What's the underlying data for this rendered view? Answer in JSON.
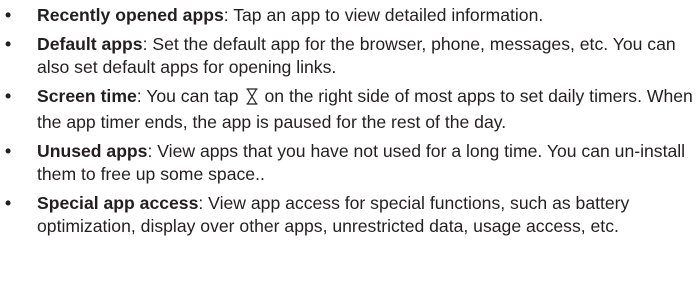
{
  "bullet_symbol": "•",
  "items": [
    {
      "term": "Recently opened apps",
      "text": ": Tap an app to view detailed information."
    },
    {
      "term": "Default apps",
      "text": ": Set the default app for the browser, phone, messages, etc. You can also set default apps for opening links."
    },
    {
      "term": "Screen time",
      "text_before_icon": ": You can tap",
      "icon": "hourglass-icon",
      "text_after_icon": "on the right side of most apps to set daily timers. When the app timer ends, the app is paused for the rest of the day."
    },
    {
      "term": "Unused apps",
      "text": ": View apps that you have not used for a long time. You can un-install them to free up some space.."
    },
    {
      "term": "Special app access",
      "text": ": View app access for special functions, such as battery optimization, display over other apps, unrestricted data, usage access, etc."
    }
  ]
}
